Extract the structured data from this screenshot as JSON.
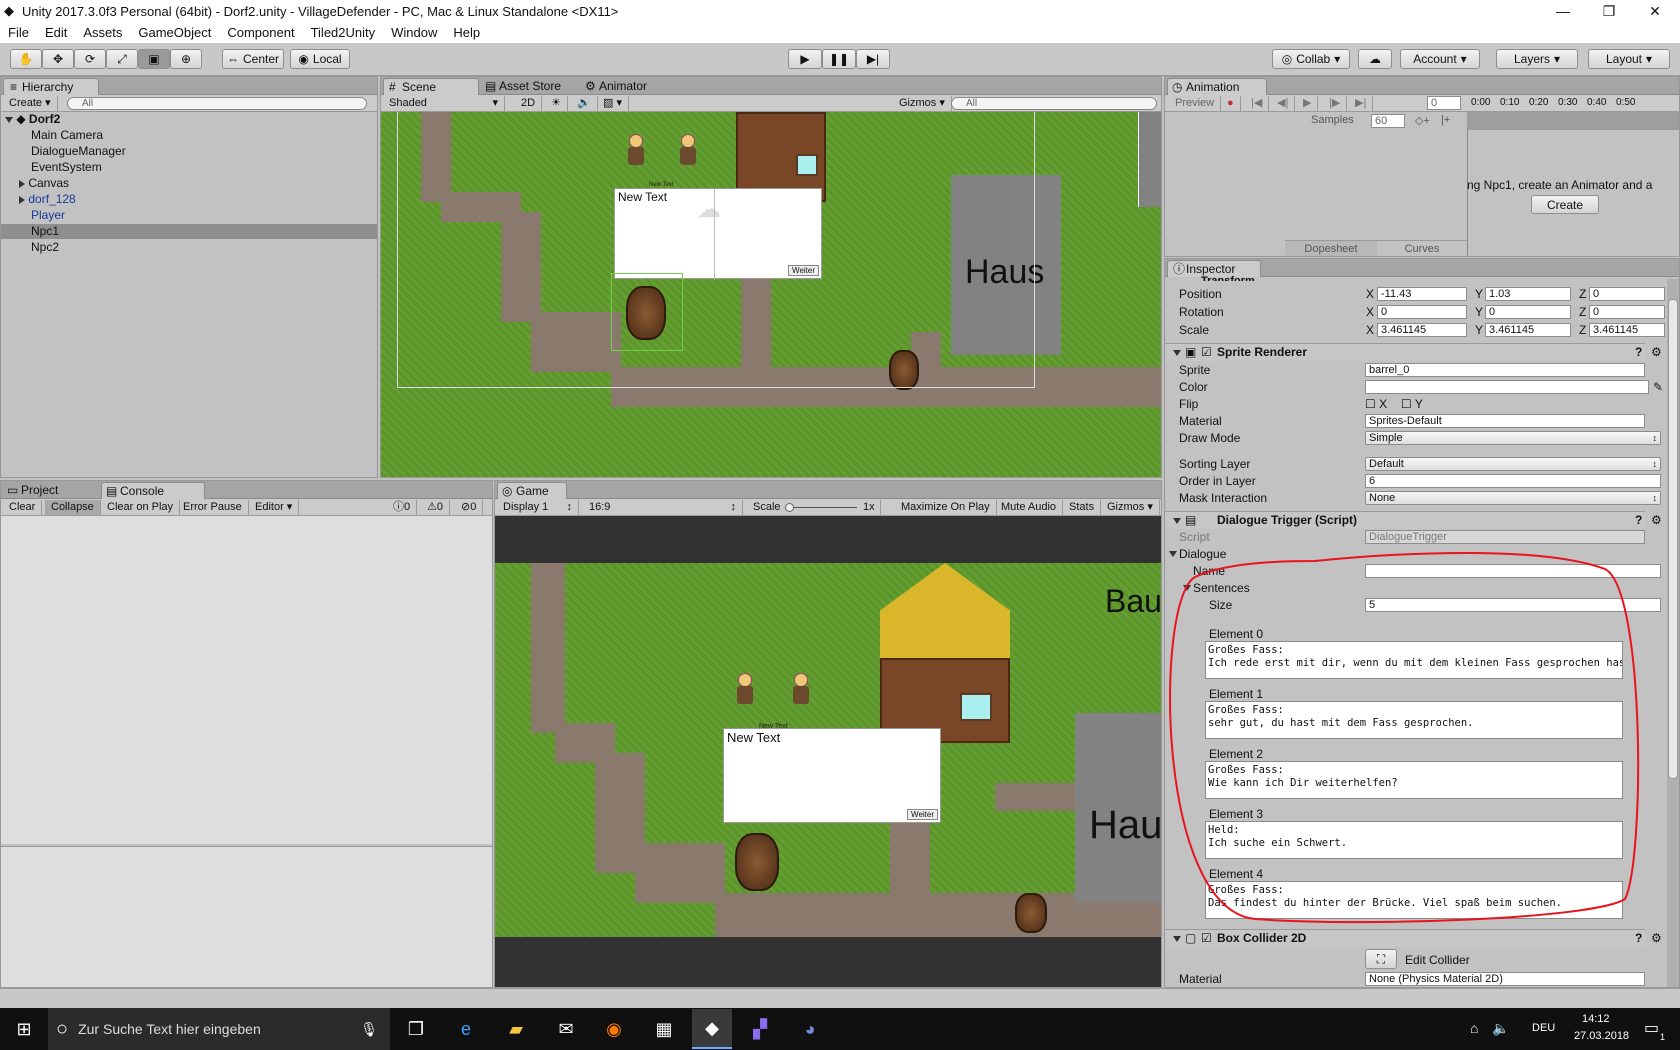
{
  "window": {
    "title": "Unity 2017.3.0f3 Personal (64bit) - Dorf2.unity - VillageDefender - PC, Mac & Linux Standalone <DX11>",
    "min": "—",
    "max": "❐",
    "close": "✕"
  },
  "menu": [
    "File",
    "Edit",
    "Assets",
    "GameObject",
    "Component",
    "Tiled2Unity",
    "Window",
    "Help"
  ],
  "toolbar": {
    "center": "Center",
    "local": "Local",
    "collab": "Collab",
    "account": "Account",
    "layers": "Layers",
    "layout": "Layout"
  },
  "hierarchy": {
    "tab": "Hierarchy",
    "create": "Create",
    "search": "All",
    "scene": "Dorf2",
    "items": [
      "Main Camera",
      "DialogueManager",
      "EventSystem",
      "Canvas",
      "dorf_128",
      "Player",
      "Npc1",
      "Npc2"
    ]
  },
  "scene": {
    "tabs": [
      "Scene",
      "Asset Store",
      "Animator"
    ],
    "shading": "Shaded",
    "mode2d": "2D",
    "gizmos": "Gizmos",
    "search": "All",
    "dialog_text": "New Text",
    "button": "Weiter",
    "haus": "Haus",
    "small_label": "New Text"
  },
  "console": {
    "tabs": [
      "Project",
      "Console"
    ],
    "buttons": [
      "Clear",
      "Collapse",
      "Clear on Play",
      "Error Pause",
      "Editor"
    ],
    "counts": [
      "0",
      "0",
      "0"
    ]
  },
  "game": {
    "tab": "Game",
    "display": "Display 1",
    "aspect": "16:9",
    "scale_label": "Scale",
    "scale_value": "1x",
    "buttons": [
      "Maximize On Play",
      "Mute Audio",
      "Stats",
      "Gizmos"
    ],
    "dialog_text": "New Text",
    "button": "Weiter",
    "haus": "Hau",
    "bau": "Bau",
    "small_label": "New Text"
  },
  "animation": {
    "tab": "Animation",
    "preview": "Preview",
    "frame": "0",
    "samples_label": "Samples",
    "samples": "60",
    "message": "ng Npc1, create an Animator and a",
    "create": "Create",
    "timeline": [
      "0:00",
      "0:10",
      "0:20",
      "0:30",
      "0:40",
      "0:50"
    ],
    "dopesheet": "Dopesheet",
    "curves": "Curves"
  },
  "inspector": {
    "tab": "Inspector",
    "transform_title": "Transform",
    "position": {
      "label": "Position",
      "x": "-11.43",
      "y": "1.03",
      "z": "0"
    },
    "rotation": {
      "label": "Rotation",
      "x": "0",
      "y": "0",
      "z": "0"
    },
    "scale": {
      "label": "Scale",
      "x": "3.461145",
      "y": "3.461145",
      "z": "3.461145"
    },
    "sprite_renderer": {
      "title": "Sprite Renderer",
      "sprite_label": "Sprite",
      "sprite": "barrel_0",
      "color_label": "Color",
      "flip_label": "Flip",
      "flip_x": "X",
      "flip_y": "Y",
      "material_label": "Material",
      "material": "Sprites-Default",
      "draw_mode_label": "Draw Mode",
      "draw_mode": "Simple",
      "sorting_layer_label": "Sorting Layer",
      "sorting_layer": "Default",
      "order_label": "Order in Layer",
      "order": "6",
      "mask_label": "Mask Interaction",
      "mask": "None"
    },
    "dialogue_trigger": {
      "title": "Dialogue Trigger (Script)",
      "script_label": "Script",
      "script": "DialogueTrigger",
      "dialogue_label": "Dialogue",
      "name_label": "Name",
      "name": "",
      "sentences_label": "Sentences",
      "size_label": "Size",
      "size": "5",
      "elements": [
        {
          "label": "Element 0",
          "text": "Großes Fass:\nIch rede erst mit dir, wenn du mit dem kleinen Fass gesprochen hast."
        },
        {
          "label": "Element 1",
          "text": "Großes Fass:\nsehr gut, du hast mit dem Fass gesprochen."
        },
        {
          "label": "Element 2",
          "text": "Großes Fass:\nWie kann ich Dir weiterhelfen?"
        },
        {
          "label": "Element 3",
          "text": "Held:\nIch suche ein Schwert."
        },
        {
          "label": "Element 4",
          "text": "Großes Fass:\nDas findest du hinter der Brücke. Viel spaß beim suchen."
        }
      ]
    },
    "box_collider": {
      "title": "Box Collider 2D",
      "edit": "Edit Collider",
      "material_label": "Material",
      "material": "None (Physics Material 2D)"
    }
  },
  "taskbar": {
    "search": "Zur Suche Text hier eingeben",
    "lang": "DEU",
    "time": "14:12",
    "date": "27.03.2018",
    "notif": "1"
  },
  "colors": {
    "annotation": "#e8141e",
    "selection": "#8f8f8f"
  }
}
